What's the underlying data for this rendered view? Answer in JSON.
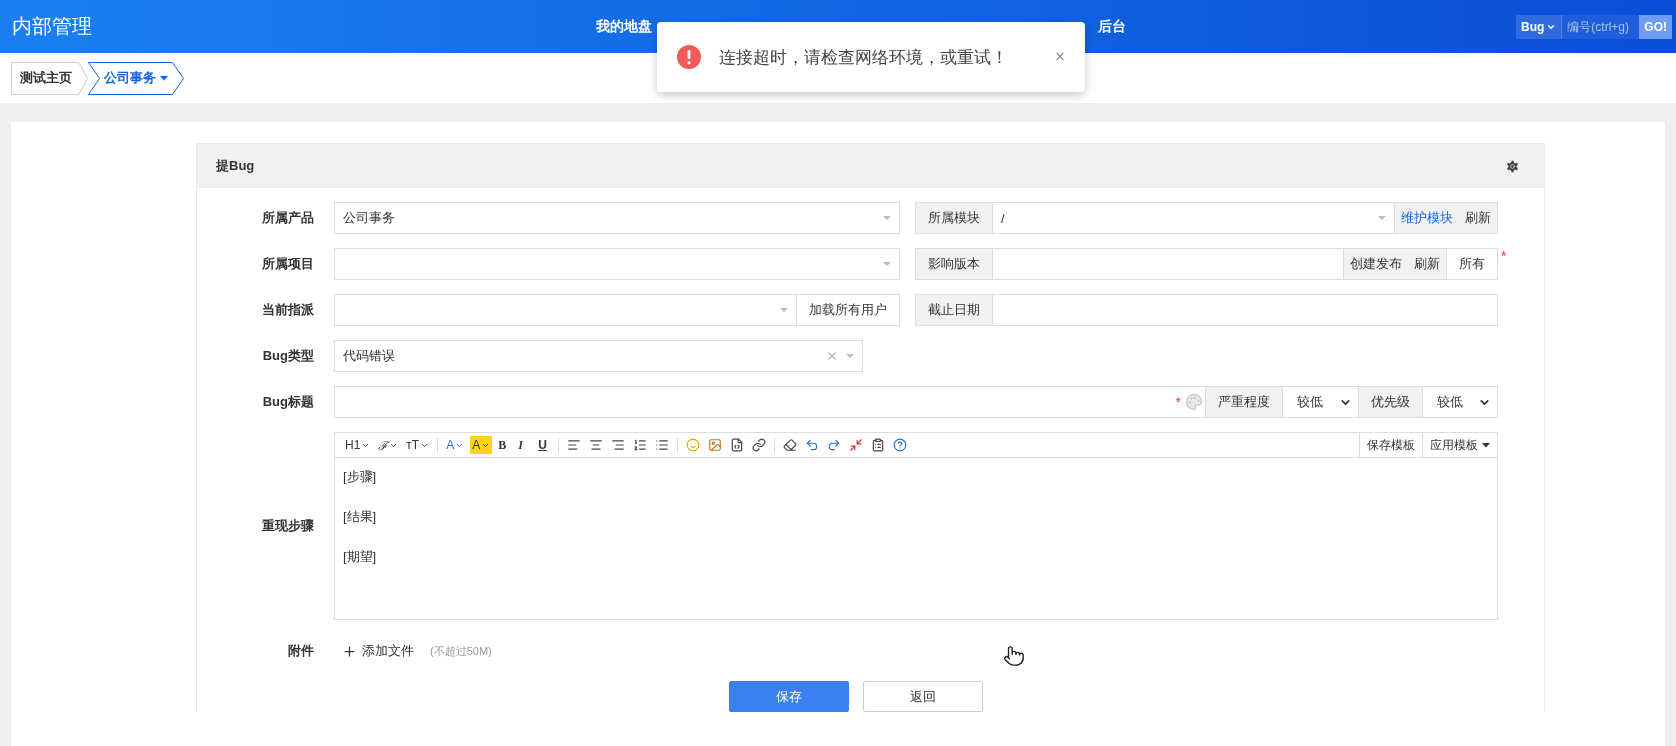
{
  "header": {
    "title": "内部管理",
    "nav": [
      {
        "label": "我的地盘"
      },
      {
        "label": "后台"
      }
    ],
    "search": {
      "type": "Bug",
      "placeholder": "编号(ctrl+g)",
      "go": "GO!"
    }
  },
  "toast": {
    "message": "连接超时，请检查网络环境，或重试！",
    "close": "×"
  },
  "breadcrumb": [
    {
      "label": "测试主页",
      "selected": false,
      "dropdown": false
    },
    {
      "label": "公司事务",
      "selected": true,
      "dropdown": true
    }
  ],
  "form": {
    "title": "提Bug",
    "product": {
      "label": "所属产品",
      "value": "公司事务"
    },
    "module": {
      "label": "所属模块",
      "value": "/",
      "actions": [
        {
          "label": "维护模块",
          "kind": "link"
        },
        {
          "label": "刷新",
          "kind": "addon"
        }
      ]
    },
    "project": {
      "label": "所属项目"
    },
    "version": {
      "label": "影响版本",
      "actions": [
        {
          "label": "创建发布",
          "kind": "addon"
        },
        {
          "label": "刷新",
          "kind": "addon"
        },
        {
          "label": "所有",
          "kind": "button"
        }
      ],
      "required_mark": "*"
    },
    "assign": {
      "label": "当前指派",
      "action": "加载所有用户"
    },
    "deadline": {
      "label": "截止日期"
    },
    "type": {
      "label": "Bug类型",
      "value": "代码错误",
      "clearable": true
    },
    "bug_title": {
      "label": "Bug标题",
      "required_mark": "*",
      "severity": {
        "label": "严重程度",
        "value": "较低"
      },
      "priority": {
        "label": "优先级",
        "value": "较低"
      }
    },
    "steps": {
      "label": "重现步骤",
      "toolbar": [
        {
          "kind": "text",
          "label": "H1",
          "dropdown": true
        },
        {
          "kind": "script",
          "label": "ℱ",
          "dropdown": true
        },
        {
          "kind": "text",
          "label": "тT",
          "dropdown": true
        },
        {
          "kind": "separator"
        },
        {
          "kind": "font-color",
          "label": "A",
          "dropdown": true
        },
        {
          "kind": "highlight",
          "label": "A",
          "dropdown": true
        },
        {
          "kind": "bold",
          "label": "B",
          "dropdown": false
        },
        {
          "kind": "italic",
          "label": "I",
          "dropdown": false
        },
        {
          "kind": "underline",
          "label": "U",
          "dropdown": false
        },
        {
          "kind": "separator"
        },
        {
          "kind": "align-left"
        },
        {
          "kind": "align-center"
        },
        {
          "kind": "align-right"
        },
        {
          "kind": "ordered-list"
        },
        {
          "kind": "bullet-list"
        },
        {
          "kind": "separator"
        },
        {
          "kind": "emoji"
        },
        {
          "kind": "image"
        },
        {
          "kind": "code"
        },
        {
          "kind": "link"
        },
        {
          "kind": "separator"
        },
        {
          "kind": "eraser"
        },
        {
          "kind": "undo"
        },
        {
          "kind": "redo"
        },
        {
          "kind": "fullscreen"
        },
        {
          "kind": "template"
        },
        {
          "kind": "help"
        }
      ],
      "template_buttons": [
        {
          "label": "保存模板",
          "dropdown": false
        },
        {
          "label": "应用模板",
          "dropdown": true
        }
      ],
      "lines": [
        "[步骤]",
        "[结果]",
        "[期望]"
      ]
    },
    "attachment": {
      "label": "附件",
      "add": "添加文件",
      "hint": "(不超过50M)"
    },
    "buttons": [
      {
        "label": "保存",
        "kind": "primary"
      },
      {
        "label": "返回",
        "kind": "default"
      }
    ]
  }
}
